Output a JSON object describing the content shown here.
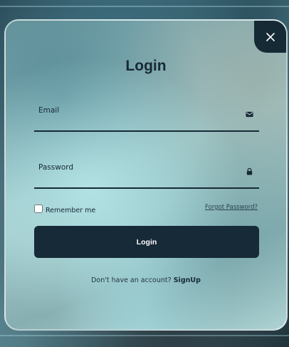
{
  "modal": {
    "title": "Login",
    "close_icon": "close-icon"
  },
  "form": {
    "email": {
      "label": "Email",
      "value": "",
      "icon": "envelope-icon"
    },
    "password": {
      "label": "Password",
      "value": "",
      "icon": "lock-icon"
    },
    "remember_label": "Remember me",
    "remember_checked": false,
    "forgot_label": "Forgot Password?",
    "submit_label": "Login"
  },
  "footer": {
    "prompt": "Don't have an account?",
    "signup_label": "SignUp"
  },
  "colors": {
    "primary": "#172a37",
    "text": "#162a36"
  }
}
